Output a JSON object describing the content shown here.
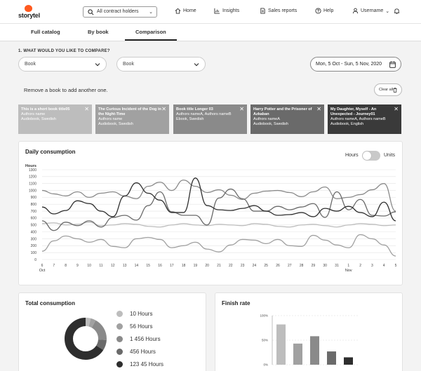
{
  "brand": {
    "name": "storytel",
    "accent": "#ff5a1f"
  },
  "topbar": {
    "search_label": "All contract holders",
    "nav": [
      {
        "label": "Home",
        "icon": "home-icon"
      },
      {
        "label": "Insights",
        "icon": "chart-icon"
      },
      {
        "label": "Sales reports",
        "icon": "document-icon"
      },
      {
        "label": "Help",
        "icon": "help-icon"
      },
      {
        "label": "Username",
        "icon": "user-icon"
      }
    ]
  },
  "tabs": [
    {
      "label": "Full catalog",
      "active": false
    },
    {
      "label": "By book",
      "active": false
    },
    {
      "label": "Comparison",
      "active": true
    }
  ],
  "compare": {
    "question": "1. WHAT WOULD YOU LIKE TO COMPARE?",
    "select1": "Book",
    "select2": "Book",
    "date_range": "Mon, 5 Oct - Sun, 5 Nov, 2020",
    "remove_hint": "Remove a book to add another one.",
    "clear_all": "Clear all"
  },
  "books": [
    {
      "title": "This is a short book title05",
      "authors": "Authors name",
      "format": "Audiobook, Swedish",
      "bg": "#bdbdbd",
      "fg": "#fff"
    },
    {
      "title": "The Curious Incident of the Dog in the Night-Time",
      "authors": "Authors name",
      "format": "Audiobook, Swedish",
      "bg": "#a1a1a1",
      "fg": "#fff"
    },
    {
      "title": "Book title Longer 03",
      "authors": "Authors nameA, Authors nameB",
      "format": "Ebook, Swedish",
      "bg": "#8a8a8a",
      "fg": "#fff"
    },
    {
      "title": "Harry Potter and the Prisoner of Azkaban",
      "authors": "Authors nameA",
      "format": "Audiobook, Swedish",
      "bg": "#6a6a6a",
      "fg": "#fff"
    },
    {
      "title": "My Daughter, Myself - An Unexpected - Journey01",
      "authors": "Authors nameA, Authors nameB",
      "format": "Audiobook, English",
      "bg": "#3a3a3a",
      "fg": "#fff"
    }
  ],
  "daily": {
    "title": "Daily consumption",
    "toggle_left": "Hours",
    "toggle_right": "Units",
    "chart_data": {
      "type": "line",
      "ylabel": "Hours",
      "ylim": [
        0,
        1300
      ],
      "yticks": [
        0,
        100,
        200,
        300,
        400,
        500,
        600,
        700,
        800,
        900,
        1000,
        1100,
        1200,
        1300
      ],
      "xticks": [
        "6",
        "7",
        "8",
        "9",
        "10",
        "11",
        "12",
        "13",
        "14",
        "15",
        "16",
        "17",
        "18",
        "19",
        "20",
        "21",
        "22",
        "23",
        "24",
        "25",
        "26",
        "27",
        "28",
        "29",
        "30",
        "31",
        "1",
        "2",
        "3",
        "4",
        "5"
      ],
      "month_labels": [
        {
          "label": "Oct",
          "at": 0
        },
        {
          "label": "Nov",
          "at": 26
        }
      ],
      "grid": true,
      "series": [
        {
          "color": "#bdbdbd",
          "values": [
            520,
            530,
            500,
            510,
            540,
            490,
            500,
            520,
            510,
            480,
            470,
            500,
            520,
            500,
            490,
            510,
            500,
            490,
            520,
            510,
            480,
            470,
            500,
            510,
            490,
            470,
            500,
            520,
            510,
            490,
            500
          ]
        },
        {
          "color": "#a1a1a1",
          "values": [
            120,
            270,
            340,
            300,
            250,
            290,
            190,
            170,
            300,
            320,
            290,
            170,
            200,
            250,
            150,
            110,
            210,
            290,
            280,
            230,
            290,
            200,
            190,
            350,
            280,
            210,
            170,
            360,
            300,
            210,
            50
          ]
        },
        {
          "color": "#8a8a8a",
          "values": [
            1000,
            950,
            920,
            980,
            900,
            960,
            980,
            920,
            880,
            1060,
            1120,
            1000,
            1150,
            1060,
            970,
            1010,
            930,
            870,
            960,
            990,
            1000,
            970,
            910,
            980,
            1050,
            880,
            900,
            940,
            1010,
            1100,
            700
          ]
        },
        {
          "color": "#6a6a6a",
          "values": [
            560,
            420,
            540,
            490,
            560,
            470,
            610,
            640,
            570,
            780,
            980,
            690,
            640,
            640,
            500,
            890,
            1020,
            880,
            700,
            700,
            770,
            720,
            760,
            810,
            610,
            980,
            720,
            870,
            640,
            630,
            690
          ]
        },
        {
          "color": "#2e2e2e",
          "values": [
            760,
            660,
            710,
            850,
            810,
            700,
            620,
            920,
            1110,
            960,
            860,
            680,
            680,
            1180,
            780,
            720,
            710,
            740,
            780,
            700,
            640,
            650,
            680,
            620,
            740,
            700,
            770,
            680,
            620,
            830,
            560
          ]
        }
      ]
    }
  },
  "total": {
    "title": "Total consumption",
    "legend": [
      {
        "label": "10 Hours",
        "color": "#bdbdbd"
      },
      {
        "label": "56 Hours",
        "color": "#a1a1a1"
      },
      {
        "label": "1 456 Hours",
        "color": "#8a8a8a"
      },
      {
        "label": "456 Hours",
        "color": "#6a6a6a"
      },
      {
        "label": "123 45 Hours",
        "color": "#2e2e2e"
      }
    ],
    "chart_data": {
      "type": "pie",
      "donut": true,
      "values": [
        4,
        4,
        18,
        8,
        66
      ],
      "colors": [
        "#bdbdbd",
        "#a1a1a1",
        "#8a8a8a",
        "#6a6a6a",
        "#2e2e2e"
      ]
    }
  },
  "finish": {
    "title": "Finish rate",
    "chart_data": {
      "type": "bar",
      "yticks": [
        "100%",
        "50%",
        "0%"
      ],
      "ylim": [
        0,
        100
      ],
      "values": [
        82,
        43,
        58,
        27,
        15
      ],
      "colors": [
        "#bdbdbd",
        "#a1a1a1",
        "#8a8a8a",
        "#6a6a6a",
        "#2e2e2e"
      ]
    }
  }
}
